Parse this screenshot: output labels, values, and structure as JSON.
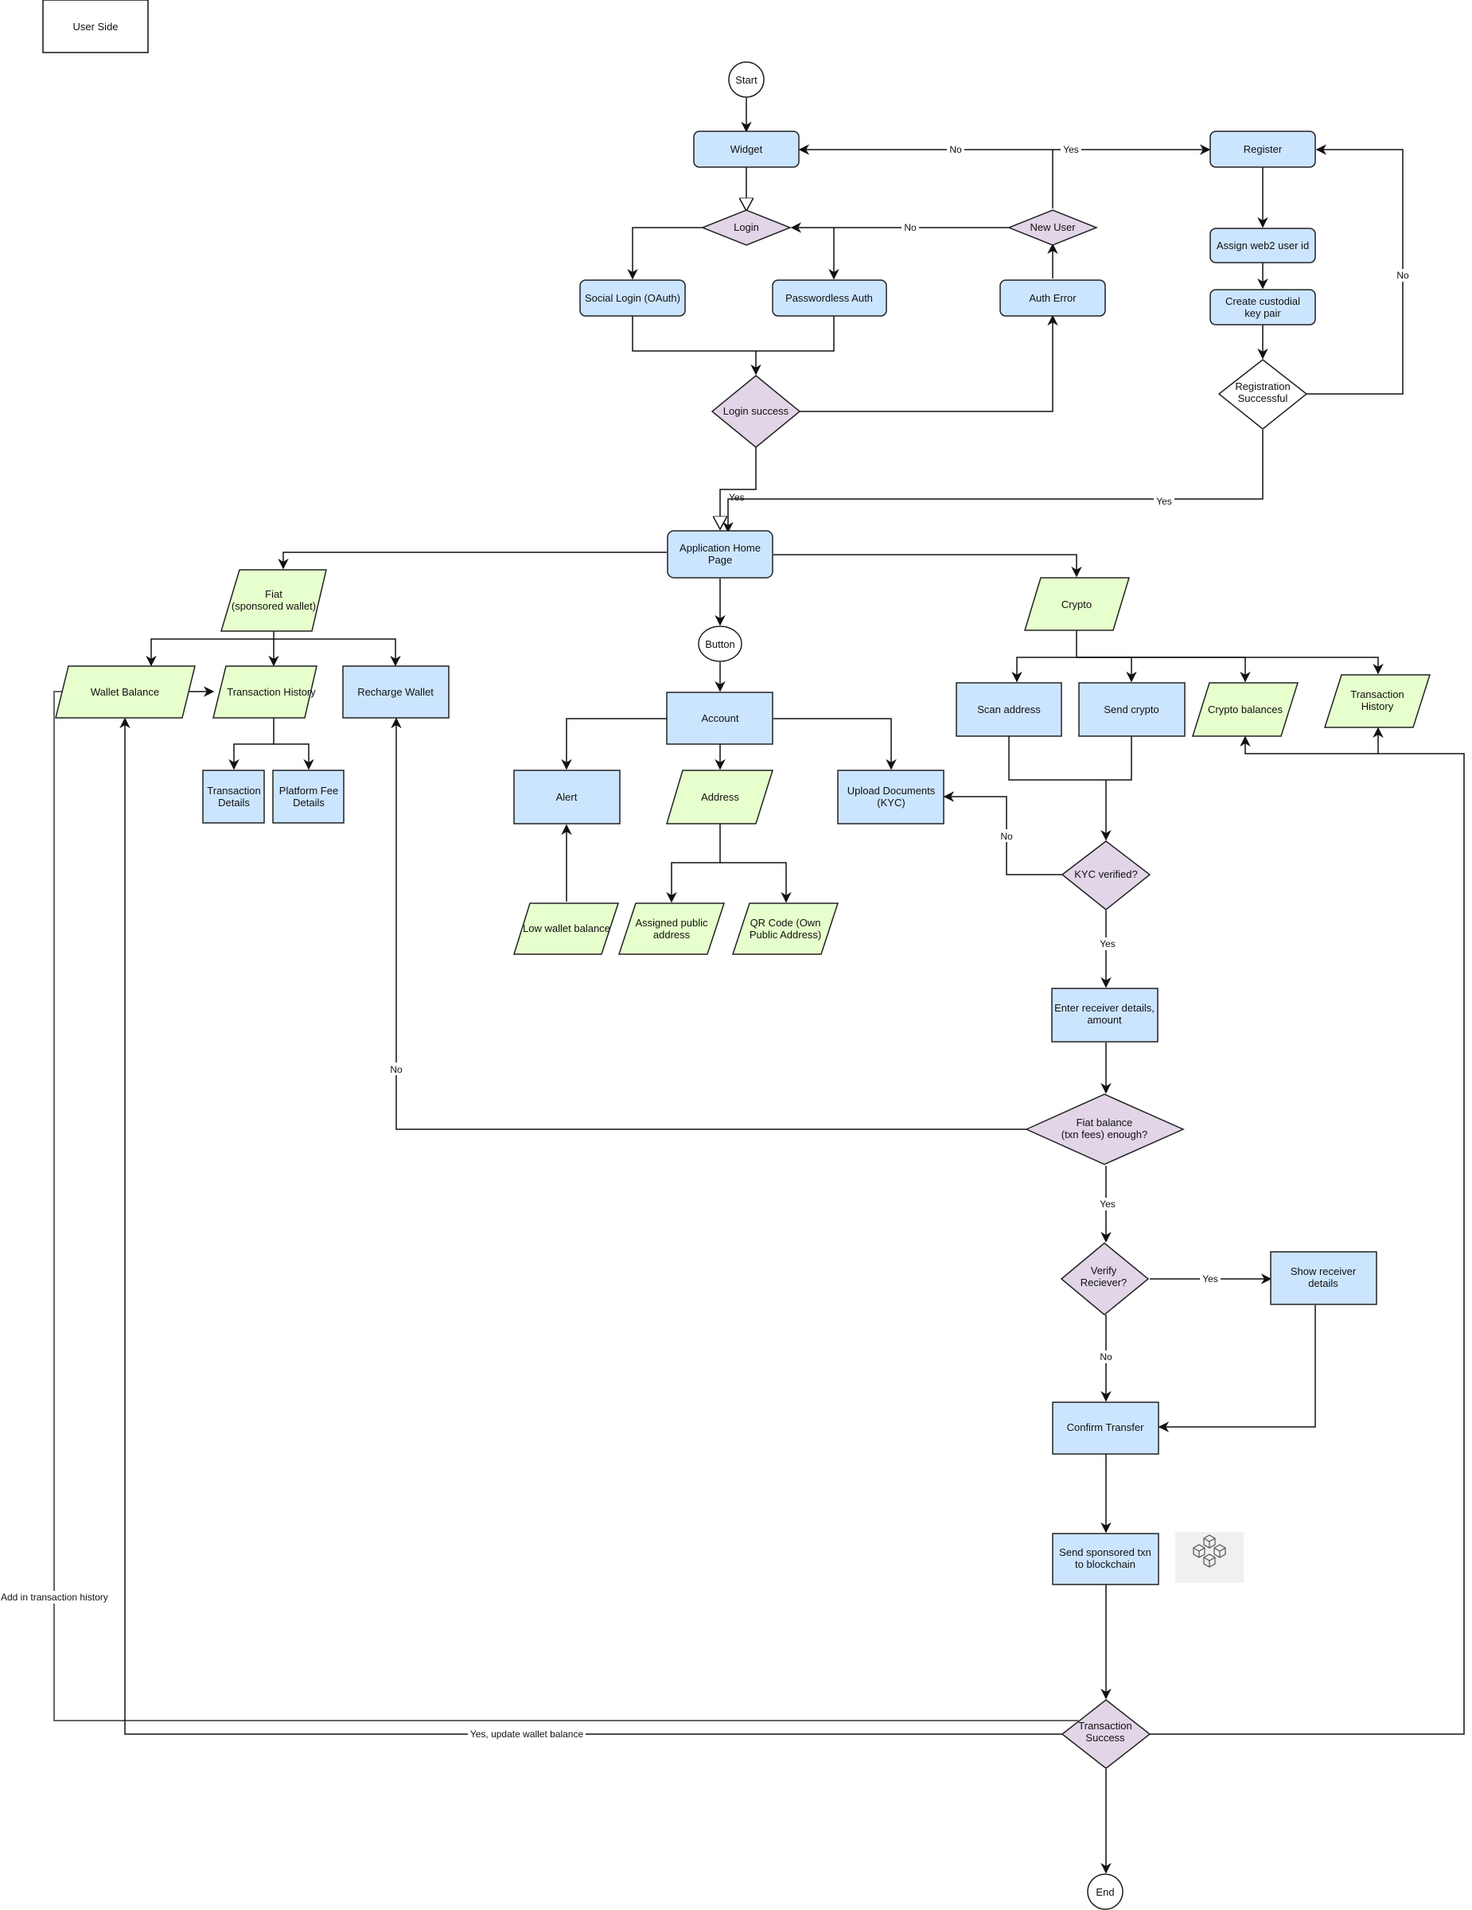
{
  "title_box": "User Side",
  "nodes": {
    "start": "Start",
    "widget": "Widget",
    "login": "Login",
    "new_user": "New User",
    "register": "Register",
    "social_login": "Social Login (OAuth)",
    "passwordless": "Passwordless Auth",
    "auth_error": "Auth Error",
    "assign_id": "Assign web2 user id",
    "custodial": [
      "Create custodial",
      "key pair"
    ],
    "login_success": "Login success",
    "reg_success": [
      "Registration",
      "Successful"
    ],
    "home": [
      "Application Home",
      "Page"
    ],
    "fiat": [
      "Fiat",
      "(sponsored wallet)"
    ],
    "crypto": "Crypto",
    "button": "Button",
    "wallet_balance": "Wallet Balance",
    "txn_history_fiat": "Transaction History",
    "recharge": "Recharge Wallet",
    "txn_details": [
      "Transaction",
      "Details"
    ],
    "platform_fee": [
      "Platform Fee",
      "Details"
    ],
    "account": "Account",
    "alert": "Alert",
    "address": "Address",
    "upload_docs": [
      "Upload Documents",
      "(KYC)"
    ],
    "low_wallet": "Low wallet balance",
    "assigned_addr": [
      "Assigned public",
      "address"
    ],
    "qr_code": [
      "QR Code (Own",
      "Public Address)"
    ],
    "scan_address": "Scan address",
    "send_crypto": "Send crypto",
    "crypto_balances": "Crypto balances",
    "txn_history_crypto": [
      "Transaction",
      "History"
    ],
    "kyc_verified": "KYC verified?",
    "enter_receiver": [
      "Enter receiver details,",
      "amount"
    ],
    "fiat_enough": [
      "Fiat balance",
      "(txn fees) enough?"
    ],
    "verify_receiver": [
      "Verify",
      "Reciever?"
    ],
    "show_receiver": [
      "Show receiver",
      "details"
    ],
    "confirm_transfer": "Confirm Transfer",
    "send_sponsored": [
      "Send sponsored txn",
      "to blockchain"
    ],
    "txn_success": [
      "Transaction",
      "Success"
    ],
    "end": "End"
  },
  "edge_labels": {
    "new_user_no_widget": "No",
    "new_user_yes_register": "Yes",
    "new_user_no_login": "No",
    "reg_no": "No",
    "login_success_yes": "Yes",
    "reg_yes": "Yes",
    "kyc_no": "No",
    "kyc_yes": "Yes",
    "fiat_no": "No",
    "fiat_yes": "Yes",
    "verify_yes": "Yes",
    "verify_no": "No",
    "add_history": "Add in transaction history",
    "update_balance": "Yes, update wallet balance"
  },
  "icons": {
    "blockchain": "blockchain-cubes-icon"
  },
  "colors": {
    "process": "#cce5ff",
    "data": "#e6ffcc",
    "decision": "#e1d5e7"
  }
}
